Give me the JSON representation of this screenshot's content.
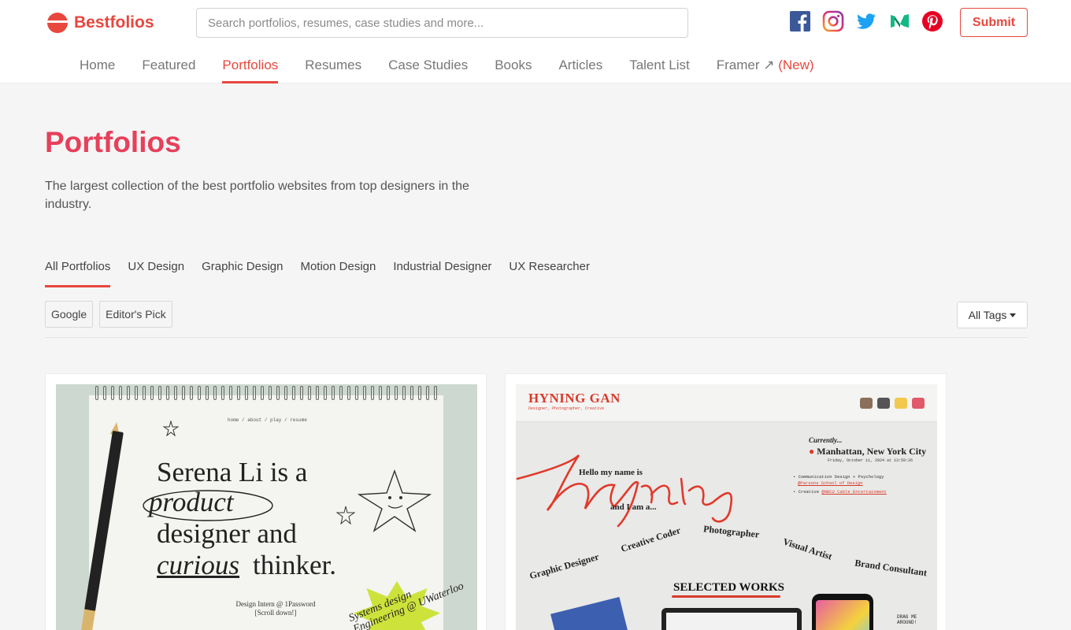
{
  "brand": {
    "name": "Bestfolios",
    "color": "#e8473e"
  },
  "search": {
    "placeholder": "Search portfolios, resumes, case studies and more...",
    "value": ""
  },
  "socials": [
    {
      "name": "facebook-icon",
      "color": "#3b5998"
    },
    {
      "name": "instagram-icon",
      "color": "#c13584"
    },
    {
      "name": "twitter-icon",
      "color": "#1da1f2"
    },
    {
      "name": "medium-icon",
      "color": "#12b886"
    },
    {
      "name": "pinterest-icon",
      "color": "#e60023"
    }
  ],
  "header": {
    "submit_label": "Submit"
  },
  "nav": {
    "items": [
      {
        "label": "Home"
      },
      {
        "label": "Featured"
      },
      {
        "label": "Portfolios",
        "active": true
      },
      {
        "label": "Resumes"
      },
      {
        "label": "Case Studies"
      },
      {
        "label": "Books"
      },
      {
        "label": "Articles"
      },
      {
        "label": "Talent List"
      }
    ],
    "framer": {
      "label": "Framer ↗",
      "badge": "(New)"
    }
  },
  "main": {
    "title": "Portfolios",
    "description": "The largest collection of the best portfolio websites from top designers in the industry."
  },
  "categories": [
    {
      "label": "All Portfolios",
      "active": true
    },
    {
      "label": "UX Design"
    },
    {
      "label": "Graphic Design"
    },
    {
      "label": "Motion Design"
    },
    {
      "label": "Industrial Designer"
    },
    {
      "label": "UX Researcher"
    }
  ],
  "chips": [
    {
      "label": "Google"
    },
    {
      "label": "Editor's Pick"
    }
  ],
  "tags_filter": {
    "label": "All Tags"
  },
  "cards": [
    {
      "mini_nav": "home  /  about  /  play  /  resume",
      "line1": "Serena Li is a",
      "line2": "product",
      "line3": "designer and",
      "line4a": "curious",
      "line4b": "thinker.",
      "role": "Design Intern @ 1Password",
      "scroll": "[Scroll down!]",
      "sticker1": "Systems design",
      "sticker2": "Engineering @ UWaterloo"
    },
    {
      "name": "HYNING GAN",
      "sub": "Designer, Photographer, Creative",
      "currently": "Currently...",
      "city": "Manhattan, New York City",
      "date": "Friday, October 11, 2024 at 13:59:26",
      "list1": "• Communication Design + Psychology",
      "list1b": "@Parsons School of Design",
      "list2": "• Creative",
      "list2b": "@NBCU Cable Entertainment",
      "hello": "Hello my name is",
      "script": "hyning",
      "iam": "and I am a...",
      "roles": [
        "Graphic Designer",
        "Creative Coder",
        "Photographer",
        "Visual Artist",
        "Brand Consultant"
      ],
      "selected": "SELECTED WORKS",
      "drag": "DRAG ME AROUND!"
    }
  ]
}
